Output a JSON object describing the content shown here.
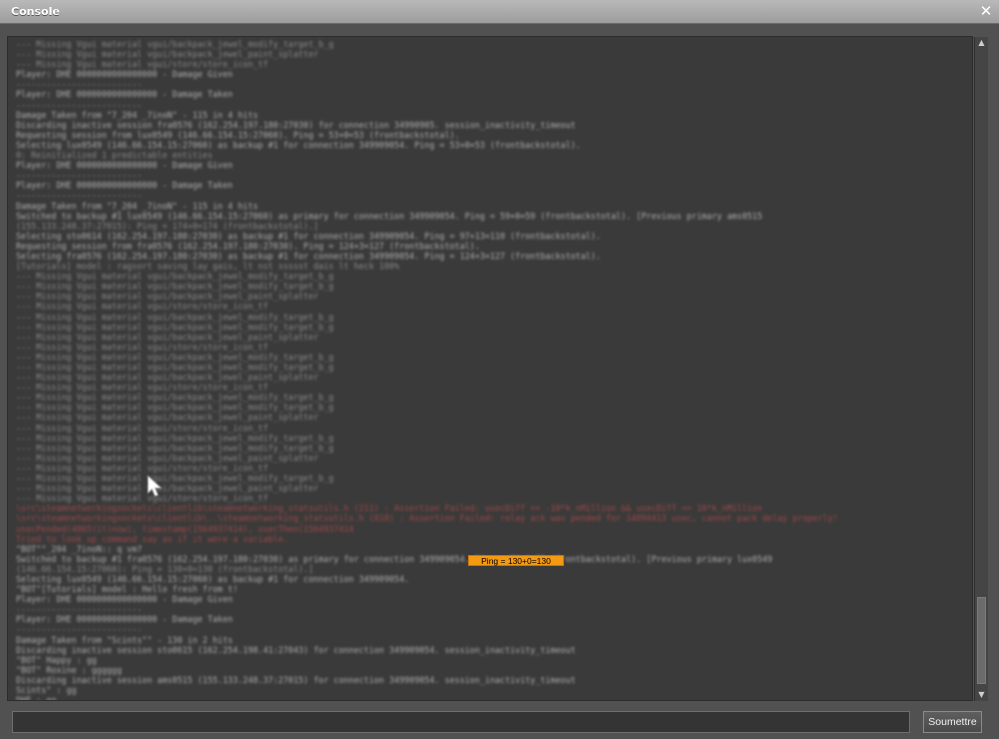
{
  "window": {
    "title": "Console",
    "close_icon": "close-icon"
  },
  "console": {
    "highlight_text": "Ping = 130+0=130",
    "log_lines": [
      {
        "text": "--- Missing Vgui material vgui/backpack_jewel_modify_target_b_g",
        "kind": "dim"
      },
      {
        "text": "--- Missing Vgui material vgui/backpack_jewel_paint_splatter",
        "kind": "dim"
      },
      {
        "text": "--- Missing Vgui material vgui/store/store_icon_tf",
        "kind": "dim"
      },
      {
        "text": "Player: DHE 0000000000000000 - Damage Given",
        "kind": "normal"
      },
      {
        "text": "-------------------------",
        "kind": "dim"
      },
      {
        "text": "Player: DHE 0000000000000000 - Damage Taken",
        "kind": "normal"
      },
      {
        "text": "-------------------------",
        "kind": "dim"
      },
      {
        "text": "Damage Taken from \"7_204 _7inoN\" - 115 in 4 hits",
        "kind": "normal"
      },
      {
        "text": "Discarding inactive session fra0576 (162.254.197.180:27030) for connection 34990905. session_inactivity_timeout",
        "kind": "normal"
      },
      {
        "text": "Requesting session from lux0549 (146.66.154.15:27060). Ping = 53+0=53 (frontbackstotal).",
        "kind": "normal"
      },
      {
        "text": "Selecting lux0549 (146.66.154.15:27060) as backup #1 for connection 349909054. Ping = 53+0=53 (frontbackstotal).",
        "kind": "normal"
      },
      {
        "text": "0: Reinitialized 1 predictable entities",
        "kind": "dim"
      },
      {
        "text": "Player: DHE 0000000000000000 - Damage Given",
        "kind": "normal"
      },
      {
        "text": "-------------------------",
        "kind": "dim"
      },
      {
        "text": "Player: DHE 0000000000000000 - Damage Taken",
        "kind": "normal"
      },
      {
        "text": "-------------------------",
        "kind": "dim"
      },
      {
        "text": "Damage Taken from \"7_204 _7inoN\" - 115 in 4 hits",
        "kind": "normal"
      },
      {
        "text": "Switched to backup #1 lux0549 (146.66.154.15:27060) as primary for connection 349909054. Ping = 59+0=59 (frontbackstotal). [Previous primary ams0515",
        "kind": "normal"
      },
      {
        "text": "(155.133.248.37:27015): Ping = 174+0=174 (frontbackstotal).]",
        "kind": "dim"
      },
      {
        "text": "Selecting sto0614 (162.254.197.180:27030) as backup #1 for connection 349909054. Ping = 97+13=110 (frontbackstotal).",
        "kind": "normal"
      },
      {
        "text": "Requesting session from fra0576 (162.254.197.180:27030). Ping = 124+3=127 (frontbackstotal).",
        "kind": "normal"
      },
      {
        "text": "Selecting fra0576 (162.254.197.180:27030) as backup #1 for connection 349909054. Ping = 124+3=127 (frontbackstotal).",
        "kind": "normal"
      },
      {
        "text": "[Tutorials] model : ragsort saving lay gais, lt nst ssssst dais lt heck 100%",
        "kind": "dim"
      },
      {
        "text": "--- Missing Vgui material vgui/backpack_jewel_modify_target_b_g",
        "kind": "dim"
      },
      {
        "text": "--- Missing Vgui material vgui/backpack_jewel_modify_target_b_g",
        "kind": "dim"
      },
      {
        "text": "--- Missing Vgui material vgui/backpack_jewel_paint_splatter",
        "kind": "dim"
      },
      {
        "text": "--- Missing Vgui material vgui/store/store_icon_tf",
        "kind": "dim"
      },
      {
        "text": "--- Missing Vgui material vgui/backpack_jewel_modify_target_b_g",
        "kind": "dim"
      },
      {
        "text": "--- Missing Vgui material vgui/backpack_jewel_modify_target_b_g",
        "kind": "dim"
      },
      {
        "text": "--- Missing Vgui material vgui/backpack_jewel_paint_splatter",
        "kind": "dim"
      },
      {
        "text": "--- Missing Vgui material vgui/store/store_icon_tf",
        "kind": "dim"
      },
      {
        "text": "--- Missing Vgui material vgui/backpack_jewel_modify_target_b_g",
        "kind": "dim"
      },
      {
        "text": "--- Missing Vgui material vgui/backpack_jewel_modify_target_b_g",
        "kind": "dim"
      },
      {
        "text": "--- Missing Vgui material vgui/backpack_jewel_paint_splatter",
        "kind": "dim"
      },
      {
        "text": "--- Missing Vgui material vgui/store/store_icon_tf",
        "kind": "dim"
      },
      {
        "text": "--- Missing Vgui material vgui/backpack_jewel_modify_target_b_g",
        "kind": "dim"
      },
      {
        "text": "--- Missing Vgui material vgui/backpack_jewel_modify_target_b_g",
        "kind": "dim"
      },
      {
        "text": "--- Missing Vgui material vgui/backpack_jewel_paint_splatter",
        "kind": "dim"
      },
      {
        "text": "--- Missing Vgui material vgui/store/store_icon_tf",
        "kind": "dim"
      },
      {
        "text": "--- Missing Vgui material vgui/backpack_jewel_modify_target_b_g",
        "kind": "dim"
      },
      {
        "text": "--- Missing Vgui material vgui/backpack_jewel_modify_target_b_g",
        "kind": "dim"
      },
      {
        "text": "--- Missing Vgui material vgui/backpack_jewel_paint_splatter",
        "kind": "dim"
      },
      {
        "text": "--- Missing Vgui material vgui/store/store_icon_tf",
        "kind": "dim"
      },
      {
        "text": "--- Missing Vgui material vgui/backpack_jewel_modify_target_b_g",
        "kind": "dim"
      },
      {
        "text": "--- Missing Vgui material vgui/backpack_jewel_paint_splatter",
        "kind": "dim"
      },
      {
        "text": "--- Missing Vgui material vgui/store/store_icon_tf",
        "kind": "dim"
      },
      {
        "text": "\\src\\steamnetworkingsockets\\clientlib\\steamnetworking_statsutils.h (211) : Assertion Failed: usecDiff >= -10*k_nMillion && usecDiff <= 10*k_nMillion",
        "kind": "red"
      },
      {
        "text": "\\src\\steamnetworkingsockets\\clientlib\\..\\steamnetworking_statsutils.h (818) : Assertion Failed: relay ack was pended for 14894413 usec, cannot pack delay properly!",
        "kind": "red"
      },
      {
        "text": "usecPended(4865(it)now), timestamp(1564937414), usecThen(1564937414",
        "kind": "red"
      },
      {
        "text": "Tried to look up command say as if it were a variable.",
        "kind": "red"
      },
      {
        "text": "\"BOT\"\"_204 _7inoN:: q vm?",
        "kind": "normal"
      },
      {
        "text": "Switched to backup #1 fra0576 (162.254.197.180:27030) as primary for connection 349909054. Ping = 73+3=76 (frontbackstotal). [Previous primary lux0549",
        "kind": "normal"
      },
      {
        "text": "(146.66.154.15:27060): Ping = 130+0=130 (frontbackstotal).]",
        "kind": "dim"
      },
      {
        "text": "Selecting lux0549 (146.66.154.15:27060) as backup #1 for connection 349909054.",
        "kind": "normal"
      },
      {
        "text": "\"BOT\"[Tutorials] model : Hello fresh from t!",
        "kind": "normal"
      },
      {
        "text": "Player: DHE 0000000000000000 - Damage Given",
        "kind": "normal"
      },
      {
        "text": "-------------------------",
        "kind": "dim"
      },
      {
        "text": "Player: DHE 0000000000000000 - Damage Taken",
        "kind": "normal"
      },
      {
        "text": "-------------------------",
        "kind": "dim"
      },
      {
        "text": "Damage Taken from \"Scints\"\" - 130 in 2 hits",
        "kind": "normal"
      },
      {
        "text": "Discarding inactive session sto0615 (162.254.198.41:27043) for connection 349909054. session_inactivity_timeout",
        "kind": "normal"
      },
      {
        "text": "\"BOT\" Happy : gg",
        "kind": "normal"
      },
      {
        "text": "\"BOT\" Roxine : gggggg",
        "kind": "normal"
      },
      {
        "text": "Discarding inactive session ams0515 (155.133.248.37:27015) for connection 349909054. session_inactivity_timeout",
        "kind": "normal"
      },
      {
        "text": "Scints\" : gg",
        "kind": "normal"
      },
      {
        "text": "DHE : gg",
        "kind": "normal"
      }
    ]
  },
  "input": {
    "value": "",
    "placeholder": ""
  },
  "submit": {
    "label": "Soumettre"
  },
  "scrollbar": {
    "up_icon": "scroll-up-arrow-icon",
    "down_icon": "scroll-down-arrow-icon",
    "position_fraction": 0.95
  }
}
